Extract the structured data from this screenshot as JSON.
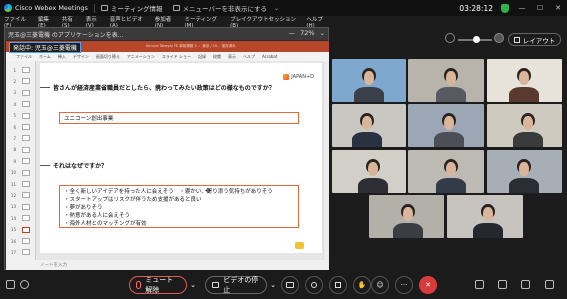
{
  "titlebar": {
    "app_name": "Cisco Webex Meetings",
    "meeting_info_label": "ミーティング情報",
    "menu_bar_hidden_label": "メニューバーを非表示にする",
    "menu_bar_hidden_chevron": "⌄",
    "time": "03:28:12",
    "minimize": "—",
    "maximize": "☐",
    "close": "✕"
  },
  "menubar": [
    "ファイル(F)",
    "編集(E)",
    "共有(S)",
    "表示(V)",
    "音声とビデオ(A)",
    "参加者(N)",
    "ミーティング(M)",
    "ブレイクアウトセッション(B)",
    "ヘルプ(H)"
  ],
  "view_controls": {
    "layout_label": "レイアウト"
  },
  "share_window": {
    "window_title": "児玉@三菱電機 のアプリケーションを表...",
    "zoom": "72%",
    "zoom_minus": "—",
    "badge": "発話中: 児玉@三菱電機",
    "ppt_title": "Kimura Takaya/ FE 事前課題 3 ・ 東京 / 10... 保存済み",
    "ppt_tabs": [
      "ファイル",
      "ホーム",
      "挿入",
      "デザイン",
      "画面切り替え",
      "アニメーション",
      "スライド ショー",
      "記録",
      "校閲",
      "表示",
      "ヘルプ",
      "Acrobat"
    ],
    "thumb_numbers": [
      "1",
      "2",
      "3",
      "4",
      "5",
      "6",
      "7",
      "8",
      "9",
      "10",
      "11",
      "12",
      "13",
      "14",
      "15",
      "16",
      "17"
    ],
    "slide": {
      "logo": "JAPAN+D",
      "question1": "皆さんが経済産業省職員だとしたら、携わってみたい政策はどの様なものですか？",
      "answer1": "ユニコーン創出事業",
      "question2": "それはなぜですか？",
      "answer2_lines": [
        "・全く新しいアイデアを持った人に会えそう　・寝かい、寄り添う気持ちがありそう",
        "・スタートアップはリスクが伴うため支援があると良い",
        "・夢がありそう",
        "・熱意がある人に会えそう",
        "・海外人材とのマッチングが有効"
      ],
      "cursor": "✥"
    },
    "notes_placeholder": "ノートを入力"
  },
  "bottombar": {
    "mute_label": "ミュート解除",
    "video_label": "ビデオの停止",
    "more": "···",
    "end": "✕",
    "chevron": "⌄"
  },
  "colors": {
    "ppt_red": "#b7472a",
    "end_red": "#d93a3a",
    "answer_border": "#e06a3a",
    "shield_green": "#2fb34a"
  }
}
